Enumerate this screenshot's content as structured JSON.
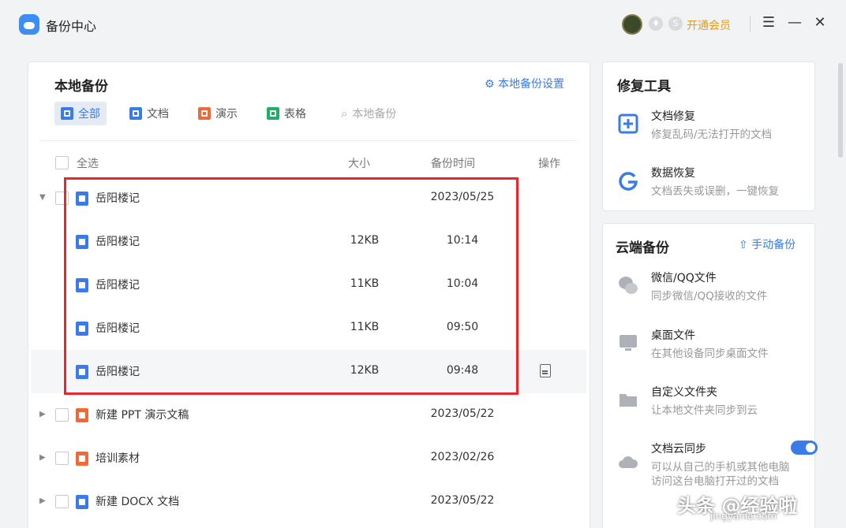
{
  "app": {
    "title": "备份中心",
    "vip_label": "开通会员"
  },
  "local": {
    "title": "本地备份",
    "settings_link": "本地备份设置",
    "tabs": [
      {
        "label": "全部",
        "color": "#3a7be8"
      },
      {
        "label": "文档",
        "color": "#3a7be8"
      },
      {
        "label": "演示",
        "color": "#ee6a3a"
      },
      {
        "label": "表格",
        "color": "#23ad6c"
      }
    ],
    "search_placeholder": "本地备份",
    "headers": {
      "select_all": "全选",
      "size": "大小",
      "time": "备份时间",
      "action": "操作"
    },
    "rows": [
      {
        "name": "岳阳楼记",
        "size": "",
        "time": "2023/05/25",
        "type": "doc"
      },
      {
        "name": "岳阳楼记",
        "size": "12KB",
        "time": "10:14",
        "type": "doc"
      },
      {
        "name": "岳阳楼记",
        "size": "11KB",
        "time": "10:04",
        "type": "doc"
      },
      {
        "name": "岳阳楼记",
        "size": "11KB",
        "time": "09:50",
        "type": "doc"
      },
      {
        "name": "岳阳楼记",
        "size": "12KB",
        "time": "09:48",
        "type": "doc"
      },
      {
        "name": "新建 PPT 演示文稿",
        "size": "",
        "time": "2023/05/22",
        "type": "ppt"
      },
      {
        "name": "培训素材",
        "size": "",
        "time": "2023/02/26",
        "type": "ppt"
      },
      {
        "name": "新建 DOCX 文档",
        "size": "",
        "time": "2023/05/22",
        "type": "doc"
      }
    ]
  },
  "repair": {
    "title": "修复工具",
    "items": [
      {
        "name": "文档修复",
        "desc": "修复乱码/无法打开的文档"
      },
      {
        "name": "数据恢复",
        "desc": "文档丢失或误删，一键恢复"
      }
    ]
  },
  "cloud": {
    "title": "云端备份",
    "manual_link": "手动备份",
    "items": [
      {
        "name": "微信/QQ文件",
        "desc": "同步微信/QQ接收的文件"
      },
      {
        "name": "桌面文件",
        "desc": "在其他设备同步桌面文件"
      },
      {
        "name": "自定义文件夹",
        "desc": "让本地文件夹同步到云"
      },
      {
        "name": "文档云同步",
        "desc": "可以从自己的手机或其他电脑",
        "desc2": "访问这台电脑打开过的文档"
      }
    ]
  },
  "watermark": {
    "line1": "头条 @经验啦",
    "line2": "jingyanla.com"
  },
  "colors": {
    "accent": "#3a7be8",
    "doc": "#3a7be8",
    "ppt": "#ee6a3a",
    "highlight_box": "#e8262d"
  }
}
